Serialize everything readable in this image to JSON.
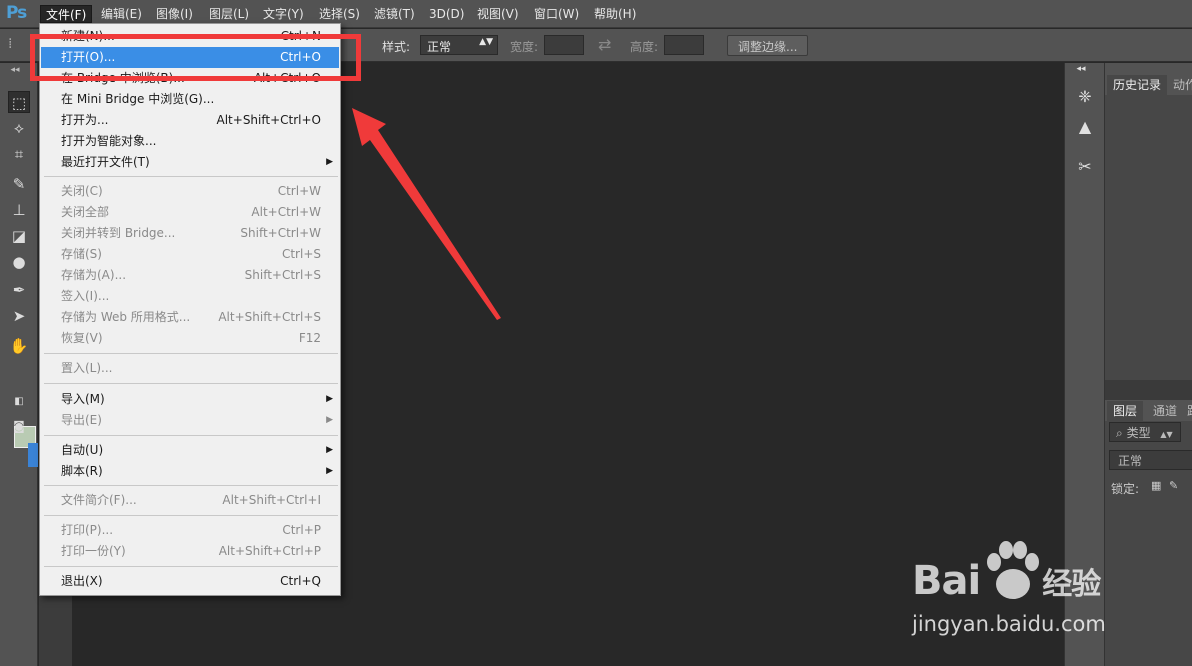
{
  "app": {
    "logo": "Ps"
  },
  "menubar": [
    {
      "id": "file",
      "label": "文件(F)"
    },
    {
      "id": "edit",
      "label": "编辑(E)"
    },
    {
      "id": "image",
      "label": "图像(I)"
    },
    {
      "id": "layer",
      "label": "图层(L)"
    },
    {
      "id": "type",
      "label": "文字(Y)"
    },
    {
      "id": "select",
      "label": "选择(S)"
    },
    {
      "id": "filter",
      "label": "滤镜(T)"
    },
    {
      "id": "3d",
      "label": "3D(D)"
    },
    {
      "id": "view",
      "label": "视图(V)"
    },
    {
      "id": "window",
      "label": "窗口(W)"
    },
    {
      "id": "help",
      "label": "帮助(H)"
    }
  ],
  "options": {
    "style_label": "样式:",
    "style_value": "正常",
    "width_label": "宽度:",
    "height_label": "高度:",
    "refine_button": "调整边缘..."
  },
  "file_menu": {
    "items": [
      {
        "label": "新建(N)...",
        "shortcut": "Ctrl+N",
        "enabled": true
      },
      {
        "label": "打开(O)...",
        "shortcut": "Ctrl+O",
        "enabled": true,
        "highlighted": true
      },
      {
        "label": "在 Bridge 中浏览(B)...",
        "shortcut": "Alt+Ctrl+O",
        "enabled": true
      },
      {
        "label": "在 Mini Bridge 中浏览(G)...",
        "shortcut": "",
        "enabled": true
      },
      {
        "label": "打开为...",
        "shortcut": "Alt+Shift+Ctrl+O",
        "enabled": true
      },
      {
        "label": "打开为智能对象...",
        "shortcut": "",
        "enabled": true
      },
      {
        "label": "最近打开文件(T)",
        "shortcut": "",
        "enabled": true,
        "submenu": true
      },
      {
        "label": "关闭(C)",
        "shortcut": "Ctrl+W",
        "enabled": false
      },
      {
        "label": "关闭全部",
        "shortcut": "Alt+Ctrl+W",
        "enabled": false
      },
      {
        "label": "关闭并转到 Bridge...",
        "shortcut": "Shift+Ctrl+W",
        "enabled": false
      },
      {
        "label": "存储(S)",
        "shortcut": "Ctrl+S",
        "enabled": false
      },
      {
        "label": "存储为(A)...",
        "shortcut": "Shift+Ctrl+S",
        "enabled": false
      },
      {
        "label": "签入(I)...",
        "shortcut": "",
        "enabled": false
      },
      {
        "label": "存储为 Web 所用格式...",
        "shortcut": "Alt+Shift+Ctrl+S",
        "enabled": false
      },
      {
        "label": "恢复(V)",
        "shortcut": "F12",
        "enabled": false
      },
      {
        "label": "置入(L)...",
        "shortcut": "",
        "enabled": false
      },
      {
        "label": "导入(M)",
        "shortcut": "",
        "enabled": true,
        "submenu": true
      },
      {
        "label": "导出(E)",
        "shortcut": "",
        "enabled": false,
        "submenu": true
      },
      {
        "label": "自动(U)",
        "shortcut": "",
        "enabled": true,
        "submenu": true
      },
      {
        "label": "脚本(R)",
        "shortcut": "",
        "enabled": true,
        "submenu": true
      },
      {
        "label": "文件简介(F)...",
        "shortcut": "Alt+Shift+Ctrl+I",
        "enabled": false
      },
      {
        "label": "打印(P)...",
        "shortcut": "Ctrl+P",
        "enabled": false
      },
      {
        "label": "打印一份(Y)",
        "shortcut": "Alt+Shift+Ctrl+P",
        "enabled": false
      },
      {
        "label": "退出(X)",
        "shortcut": "Ctrl+Q",
        "enabled": true
      }
    ]
  },
  "panels": {
    "history_tab": "历史记录",
    "actions_tab": "动作",
    "layers_tab": "图层",
    "channels_tab": "通道",
    "paths_tab": "路",
    "filter_kind": "类型",
    "blend_mode": "正常",
    "lock_label": "锁定:"
  },
  "colors": {
    "highlight": "#3a8ee6",
    "annotation_red": "#f03a3a",
    "foreground_swatch": "#b9cbb3",
    "background_swatch": "#3a83d6"
  },
  "watermark": {
    "logo": "Bai du 经验",
    "url": "jingyan.baidu.com"
  }
}
